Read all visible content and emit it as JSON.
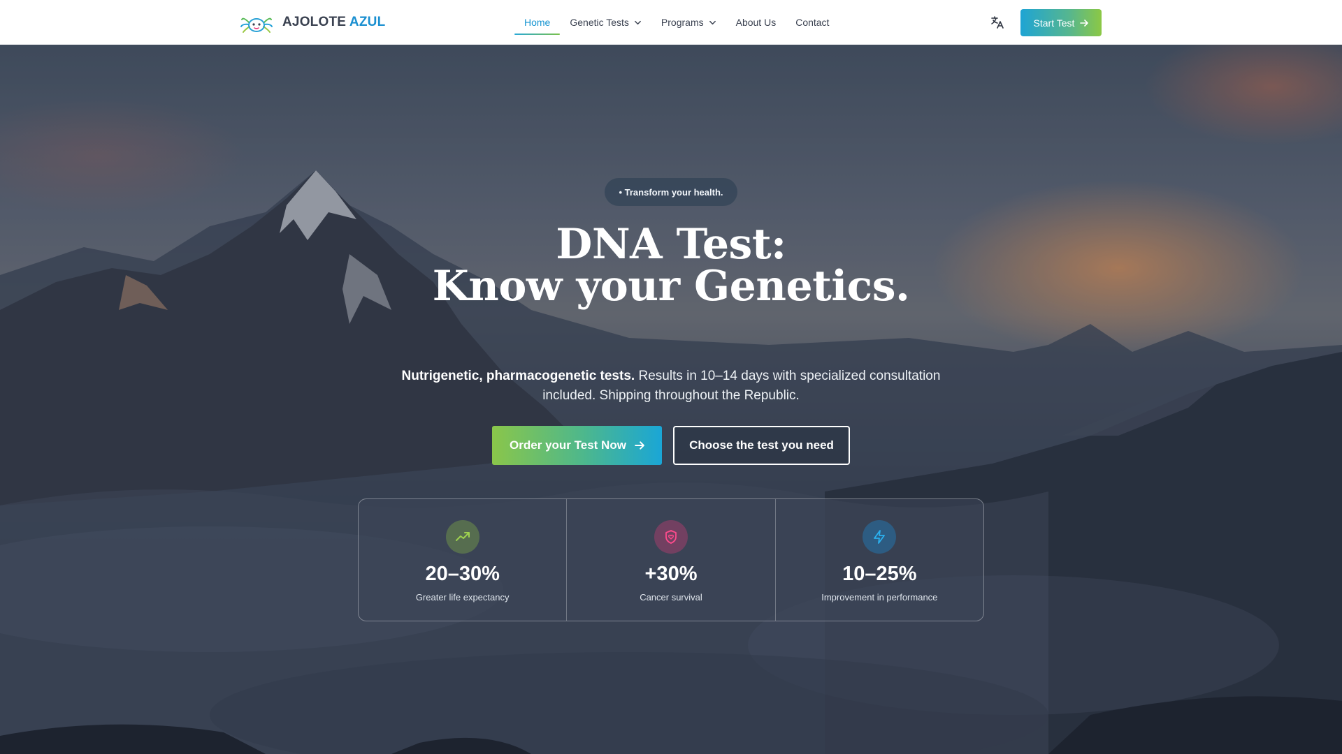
{
  "brand": {
    "name_part1": "AJOLOTE",
    "name_part2": "AZUL",
    "logo_icon": "axolotl-logo-icon"
  },
  "nav": {
    "items": [
      {
        "label": "Home",
        "active": true
      },
      {
        "label": "Genetic Tests",
        "dropdown": true
      },
      {
        "label": "Programs",
        "dropdown": true
      },
      {
        "label": "About Us"
      },
      {
        "label": "Contact"
      }
    ],
    "language_icon": "translate-icon",
    "start_button": "Start Test"
  },
  "hero": {
    "badge": "• Transform  your health.",
    "title_line1": "DNA Test:",
    "title_line2": "Know your Genetics.",
    "subtitle_bold": "Nutrigenetic, pharmacogenetic tests.",
    "subtitle_rest": " Results in 10–14 days with specialized consultation included. Shipping throughout the Republic.",
    "primary_button": "Order your Test Now",
    "secondary_button": "Choose the test you need"
  },
  "stats": [
    {
      "value": "20–30%",
      "label": "Greater life expectancy",
      "icon": "trending-up-icon",
      "color": "#9ed04f"
    },
    {
      "value": "+30%",
      "label": "Cancer survival",
      "icon": "shield-heart-icon",
      "color": "#e8397a"
    },
    {
      "value": "10–25%",
      "label": "Improvement in performance",
      "icon": "lightning-icon",
      "color": "#27a7e0"
    }
  ],
  "colors": {
    "accent_blue": "#1795d1",
    "accent_green": "#8ac64a"
  }
}
